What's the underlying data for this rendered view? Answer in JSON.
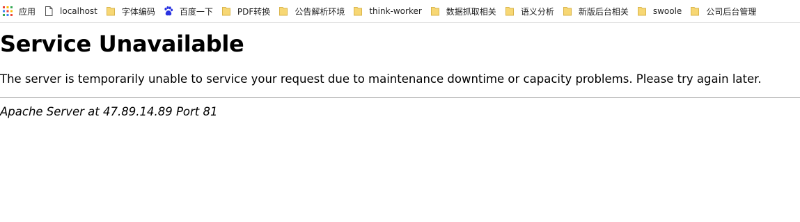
{
  "bookmarks": {
    "apps": {
      "label": "应用",
      "icon": "apps-grid-icon"
    },
    "items": [
      {
        "label": "localhost",
        "icon": "page-icon"
      },
      {
        "label": "字体编码",
        "icon": "folder-icon"
      },
      {
        "label": "百度一下",
        "icon": "baidu-paw-icon"
      },
      {
        "label": "PDF转换",
        "icon": "folder-icon"
      },
      {
        "label": "公告解析环境",
        "icon": "folder-icon"
      },
      {
        "label": "think-worker",
        "icon": "folder-icon"
      },
      {
        "label": "数据抓取相关",
        "icon": "folder-icon"
      },
      {
        "label": "语义分析",
        "icon": "folder-icon"
      },
      {
        "label": "新版后台相关",
        "icon": "folder-icon"
      },
      {
        "label": "swoole",
        "icon": "folder-icon"
      },
      {
        "label": "公司后台管理",
        "icon": "folder-icon"
      }
    ]
  },
  "page": {
    "title": "Service Unavailable",
    "message": "The server is temporarily unable to service your request due to maintenance downtime or capacity problems. Please try again later.",
    "signature": "Apache Server at 47.89.14.89 Port 81"
  },
  "colors": {
    "folder": "#f7d774",
    "folder_border": "#d9b44a",
    "baidu": "#2932e1",
    "divider": "#a0a0a0"
  }
}
